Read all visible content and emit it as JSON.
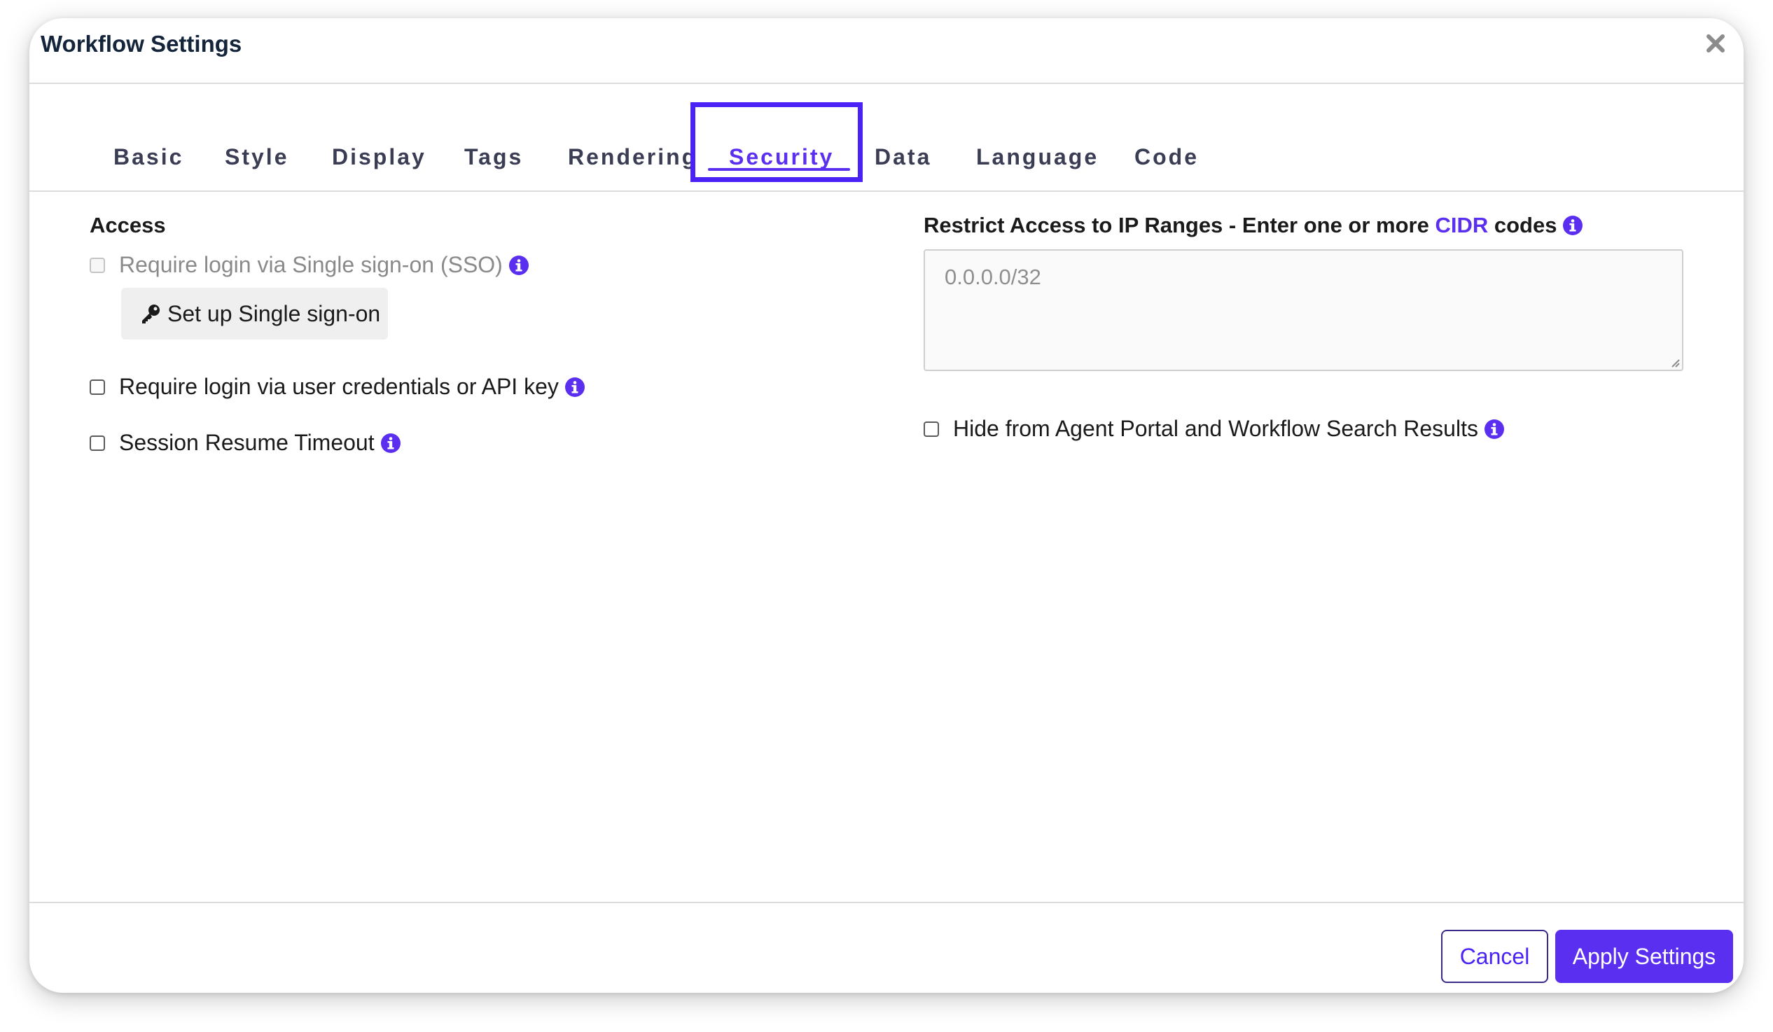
{
  "dialog": {
    "title": "Workflow Settings",
    "close_icon": "close-icon"
  },
  "tabs": [
    {
      "label": "Basic",
      "active": false
    },
    {
      "label": "Style",
      "active": false
    },
    {
      "label": "Display",
      "active": false
    },
    {
      "label": "Tags",
      "active": false
    },
    {
      "label": "Rendering",
      "active": false
    },
    {
      "label": "Security",
      "active": true
    },
    {
      "label": "Data",
      "active": false
    },
    {
      "label": "Language",
      "active": false
    },
    {
      "label": "Code",
      "active": false
    }
  ],
  "access": {
    "title": "Access",
    "sso_checkbox": {
      "label": "Require login via Single sign-on (SSO)",
      "checked": false,
      "disabled": true
    },
    "sso_button": {
      "label": "Set up Single sign-on",
      "icon": "key-icon"
    },
    "credentials_checkbox": {
      "label": "Require login via user credentials or API key",
      "checked": false
    },
    "session_checkbox": {
      "label": "Session Resume Timeout",
      "checked": false
    }
  },
  "ip_ranges": {
    "title_prefix": "Restrict Access to IP Ranges - Enter one or more ",
    "title_link": "CIDR",
    "title_suffix": " codes",
    "placeholder": "0.0.0.0/32",
    "value": ""
  },
  "hide_checkbox": {
    "label": "Hide from Agent Portal and Workflow Search Results",
    "checked": false
  },
  "footer": {
    "cancel_label": "Cancel",
    "apply_label": "Apply Settings"
  },
  "colors": {
    "accent": "#5b2ff0",
    "highlight_border": "#4a22f5",
    "title_text": "#14243a"
  }
}
